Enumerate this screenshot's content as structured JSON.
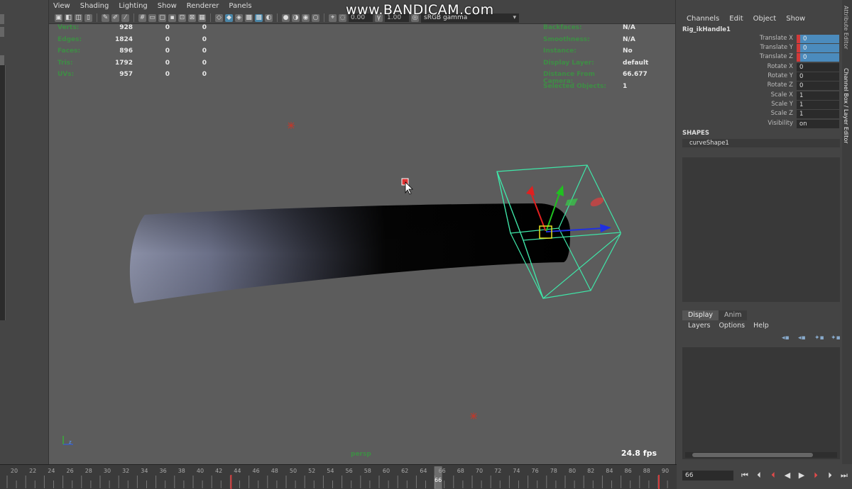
{
  "viewport": {
    "menu": [
      "View",
      "Shading",
      "Lighting",
      "Show",
      "Renderer",
      "Panels"
    ],
    "toolbar": {
      "field1": "0.00",
      "field2": "1.00",
      "color_space": "sRGB gamma"
    },
    "watermark": "www.BANDICAM.com",
    "hud_left": [
      {
        "label": "Verts:",
        "v1": "928",
        "v2": "0",
        "v3": "0"
      },
      {
        "label": "Edges:",
        "v1": "1824",
        "v2": "0",
        "v3": "0"
      },
      {
        "label": "Faces:",
        "v1": "896",
        "v2": "0",
        "v3": "0"
      },
      {
        "label": "Tris:",
        "v1": "1792",
        "v2": "0",
        "v3": "0"
      },
      {
        "label": "UVs:",
        "v1": "957",
        "v2": "0",
        "v3": "0"
      }
    ],
    "hud_right": [
      {
        "label": "Backfaces:",
        "value": "N/A"
      },
      {
        "label": "Smoothness:",
        "value": "N/A"
      },
      {
        "label": "Instance:",
        "value": "No"
      },
      {
        "label": "Display Layer:",
        "value": "default"
      },
      {
        "label": "Distance From Camera:",
        "value": "66.677"
      },
      {
        "label": "Selected Objects:",
        "value": "1"
      }
    ],
    "camera": "persp",
    "fps": "24.8 fps"
  },
  "channel_box": {
    "menu": [
      "Channels",
      "Edit",
      "Object",
      "Show"
    ],
    "node": "Rig_ikHandle1",
    "attributes": [
      {
        "name": "Translate X",
        "value": "0",
        "keyed": true
      },
      {
        "name": "Translate Y",
        "value": "0",
        "keyed": true
      },
      {
        "name": "Translate Z",
        "value": "0",
        "keyed": true
      },
      {
        "name": "Rotate X",
        "value": "0",
        "keyed": false
      },
      {
        "name": "Rotate Y",
        "value": "0",
        "keyed": false
      },
      {
        "name": "Rotate Z",
        "value": "0",
        "keyed": false
      },
      {
        "name": "Scale X",
        "value": "1",
        "keyed": false
      },
      {
        "name": "Scale Y",
        "value": "1",
        "keyed": false
      },
      {
        "name": "Scale Z",
        "value": "1",
        "keyed": false
      },
      {
        "name": "Visibility",
        "value": "on",
        "keyed": false
      }
    ],
    "shapes_header": "SHAPES",
    "shape": "curveShape1"
  },
  "layer_editor": {
    "tabs": [
      "Display",
      "Anim"
    ],
    "menu": [
      "Layers",
      "Options",
      "Help"
    ]
  },
  "side_tabs": [
    "Attribute Editor",
    "Channel Box / Layer Editor"
  ],
  "timeline": {
    "ticks": [
      "20",
      "22",
      "24",
      "26",
      "28",
      "30",
      "32",
      "34",
      "36",
      "38",
      "40",
      "42",
      "44",
      "46",
      "48",
      "50",
      "52",
      "54",
      "56",
      "58",
      "60",
      "62",
      "64",
      "66",
      "68",
      "70",
      "72",
      "74",
      "76",
      "78",
      "80",
      "82",
      "84",
      "86",
      "88",
      "90"
    ],
    "current_frame": "66"
  },
  "playback": {
    "frame_value": "66"
  },
  "colors": {
    "hud_label": "#3e8e45",
    "keyed_attr": "#4b8bbd",
    "key_marker": "#d23a3a",
    "viewport_bg": "#5c5c5c"
  }
}
